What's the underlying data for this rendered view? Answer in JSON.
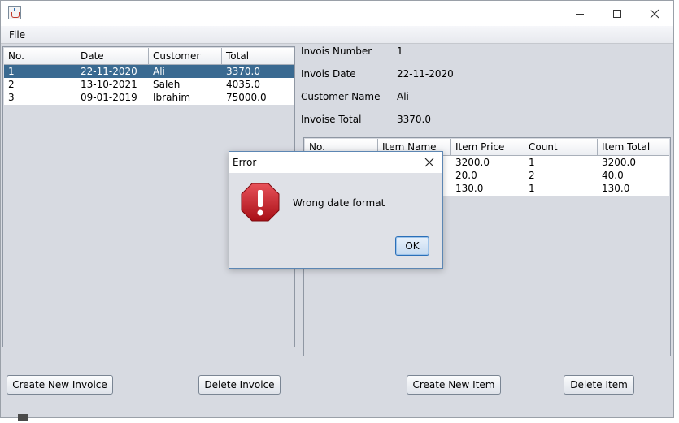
{
  "window": {
    "title": "",
    "minimize_icon": "minimize-icon",
    "maximize_icon": "maximize-icon",
    "close_icon": "close-icon"
  },
  "menu": {
    "items": [
      "File"
    ]
  },
  "invoices_table": {
    "columns": [
      "No.",
      "Date",
      "Customer",
      "Total"
    ],
    "rows": [
      [
        "1",
        "22-11-2020",
        "Ali",
        "3370.0"
      ],
      [
        "2",
        "13-10-2021",
        "Saleh",
        "4035.0"
      ],
      [
        "3",
        "09-01-2019",
        "Ibrahim",
        "75000.0"
      ]
    ],
    "selected_row": 0
  },
  "invoice_details": {
    "number_label": "Invois Number",
    "number_value": "1",
    "date_label": "Invois Date",
    "date_value": "22-11-2020",
    "customer_label": "Customer Name",
    "customer_value": "Ali",
    "total_label": "Invoise Total",
    "total_value": "3370.0"
  },
  "items_table": {
    "columns": [
      "No.",
      "Item Name",
      "Item Price",
      "Count",
      "Item Total"
    ],
    "rows": [
      [
        "",
        "",
        "3200.0",
        "1",
        "3200.0"
      ],
      [
        "",
        "",
        "20.0",
        "2",
        "40.0"
      ],
      [
        "",
        "",
        "130.0",
        "1",
        "130.0"
      ]
    ]
  },
  "buttons": {
    "create_invoice": "Create New Invoice",
    "delete_invoice": "Delete Invoice",
    "create_item": "Create New Item",
    "delete_item": "Delete Item"
  },
  "dialog": {
    "title": "Error",
    "message": "Wrong date format",
    "ok_label": "OK",
    "icon": "error-icon",
    "close_icon": "close-icon",
    "colors": {
      "error_red": "#c8181e",
      "focus_blue": "#2b6fb8"
    }
  },
  "colors": {
    "selection": "#3a6a91",
    "panel_bg": "#d7dae1"
  }
}
